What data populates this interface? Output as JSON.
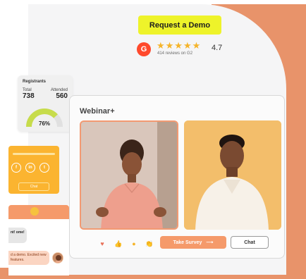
{
  "header": {
    "demo_label": "Request a Demo",
    "g2_mark": "G",
    "stars": "★★★★★",
    "reviews_text": "414 reviews on G2",
    "rating": "4.7"
  },
  "registrants": {
    "title": "Registrants",
    "total_label": "Total",
    "total_value": "738",
    "attended_label": "Attended",
    "attended_value": "560",
    "percent_text": "76%",
    "percent": 76
  },
  "social": {
    "icons": [
      "f",
      "in",
      "t"
    ],
    "chat_label": "Chat"
  },
  "chat_widget": {
    "bubble_gray": "nt! ome!",
    "bubble_orange": "d a demo. Excited new features."
  },
  "webinar": {
    "title": "Webinar+",
    "survey_label": "Take Survey",
    "survey_arrow": "⟶",
    "chat_label": "Chat",
    "reactions": [
      "♥",
      "👍",
      "●",
      "👏"
    ]
  },
  "colors": {
    "accent_orange": "#f59a6a",
    "demo_yellow": "#eef32a",
    "gauge_green": "#c7dc4b",
    "star_gold": "#f5b42a"
  }
}
